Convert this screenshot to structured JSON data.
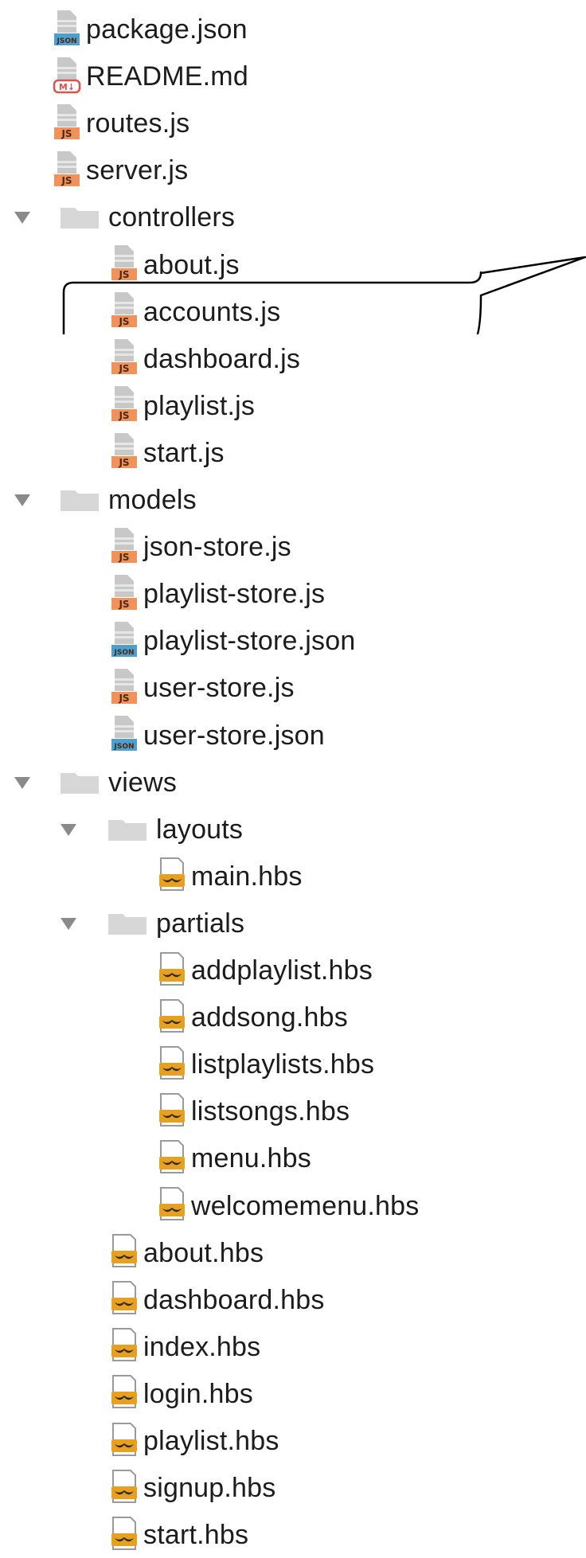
{
  "tree": [
    {
      "label": "package.json",
      "type": "json",
      "level": 1
    },
    {
      "label": "README.md",
      "type": "md",
      "level": 1
    },
    {
      "label": "routes.js",
      "type": "js",
      "level": 1
    },
    {
      "label": "server.js",
      "type": "js",
      "level": 1
    },
    {
      "label": "controllers",
      "type": "folder",
      "level": 1,
      "expanded": true
    },
    {
      "label": "about.js",
      "type": "js",
      "level": 2
    },
    {
      "label": "accounts.js",
      "type": "js",
      "level": 2,
      "highlighted": true
    },
    {
      "label": "dashboard.js",
      "type": "js",
      "level": 2
    },
    {
      "label": "playlist.js",
      "type": "js",
      "level": 2
    },
    {
      "label": "start.js",
      "type": "js",
      "level": 2
    },
    {
      "label": "models",
      "type": "folder",
      "level": 1,
      "expanded": true
    },
    {
      "label": "json-store.js",
      "type": "js",
      "level": 2
    },
    {
      "label": "playlist-store.js",
      "type": "js",
      "level": 2
    },
    {
      "label": "playlist-store.json",
      "type": "json",
      "level": 2
    },
    {
      "label": "user-store.js",
      "type": "js",
      "level": 2
    },
    {
      "label": "user-store.json",
      "type": "json",
      "level": 2
    },
    {
      "label": "views",
      "type": "folder",
      "level": 1,
      "expanded": true
    },
    {
      "label": "layouts",
      "type": "folder",
      "level": 2,
      "expanded": true
    },
    {
      "label": "main.hbs",
      "type": "hbs",
      "level": 3
    },
    {
      "label": "partials",
      "type": "folder",
      "level": 2,
      "expanded": true
    },
    {
      "label": "addplaylist.hbs",
      "type": "hbs",
      "level": 3
    },
    {
      "label": "addsong.hbs",
      "type": "hbs",
      "level": 3
    },
    {
      "label": "listplaylists.hbs",
      "type": "hbs",
      "level": 3
    },
    {
      "label": "listsongs.hbs",
      "type": "hbs",
      "level": 3
    },
    {
      "label": "menu.hbs",
      "type": "hbs",
      "level": 3
    },
    {
      "label": "welcomemenu.hbs",
      "type": "hbs",
      "level": 3
    },
    {
      "label": "about.hbs",
      "type": "hbs",
      "level": 2
    },
    {
      "label": "dashboard.hbs",
      "type": "hbs",
      "level": 2
    },
    {
      "label": "index.hbs",
      "type": "hbs",
      "level": 2
    },
    {
      "label": "login.hbs",
      "type": "hbs",
      "level": 2
    },
    {
      "label": "playlist.hbs",
      "type": "hbs",
      "level": 2
    },
    {
      "label": "signup.hbs",
      "type": "hbs",
      "level": 2
    },
    {
      "label": "start.hbs",
      "type": "hbs",
      "level": 2
    }
  ],
  "icons": {
    "js": "js-file-icon",
    "json": "json-file-icon",
    "md": "markdown-file-icon",
    "hbs": "handlebars-file-icon",
    "folder": "folder-icon",
    "expand": "disclosure-triangle-icon"
  },
  "colors": {
    "js_badge": "#f0925a",
    "json_badge": "#4e9fce",
    "md_badge": "#d9534f",
    "hbs_mustache": "#e8a020",
    "folder": "#d7d7d7",
    "arrow": "#8a8a8a",
    "text": "#1c1c1c",
    "callout_stroke": "#000000"
  }
}
